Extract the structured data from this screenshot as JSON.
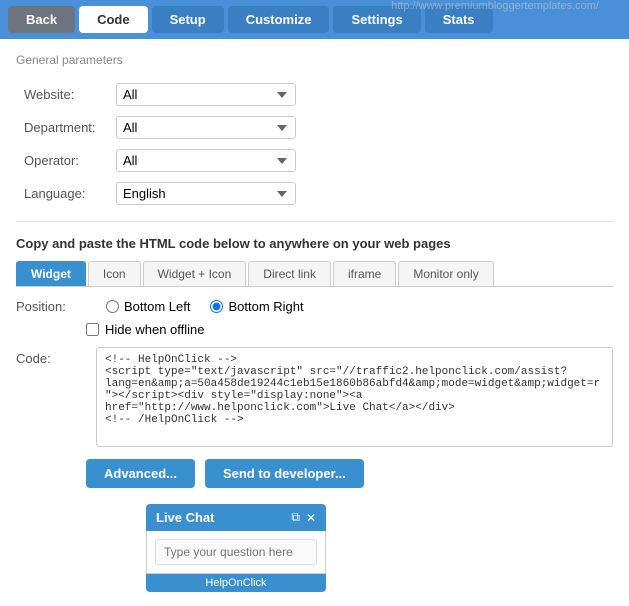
{
  "nav": {
    "back_label": "Back",
    "code_label": "Code",
    "setup_label": "Setup",
    "customize_label": "Customize",
    "settings_label": "Settings",
    "stats_label": "Stats"
  },
  "general_params": {
    "title": "General parameters",
    "website_label": "Website:",
    "website_value": "All",
    "department_label": "Department:",
    "department_value": "All",
    "operator_label": "Operator:",
    "operator_value": "All",
    "language_label": "Language:",
    "language_value": "English"
  },
  "copy_section": {
    "instruction": "Copy and paste the HTML code below to anywhere on your web pages"
  },
  "tabs": [
    {
      "id": "widget",
      "label": "Widget",
      "active": true
    },
    {
      "id": "icon",
      "label": "Icon",
      "active": false
    },
    {
      "id": "widget-icon",
      "label": "Widget + Icon",
      "active": false
    },
    {
      "id": "direct-link",
      "label": "Direct link",
      "active": false
    },
    {
      "id": "iframe",
      "label": "iframe",
      "active": false
    },
    {
      "id": "monitor-only",
      "label": "Monitor only",
      "active": false
    }
  ],
  "position": {
    "label": "Position:",
    "options": [
      {
        "id": "bottom-left",
        "label": "Bottom Left",
        "checked": false
      },
      {
        "id": "bottom-right",
        "label": "Bottom Right",
        "checked": true
      }
    ],
    "hide_offline_label": "Hide when offline"
  },
  "code_section": {
    "label": "Code:",
    "value": "<!-- HelpOnClick -->\n<script type=\"text/javascript\" src=\"//traffic2.helponclick.com/assist?lang=en&amp;a=50a458de19244c1eb15e1860b86abfd4&amp;mode=widget&amp;widget=r\"></script><div style=\"display:none\"><a href=\"http://www.helponclick.com\">Live Chat</a></div>\n<!-- /HelpOnClick -->"
  },
  "buttons": {
    "advanced_label": "Advanced...",
    "send_developer_label": "Send to developer..."
  },
  "widget_preview": {
    "title": "Live Chat",
    "external_icon": "⧉",
    "close_icon": "✕",
    "input_placeholder": "Type your question here",
    "footer": "HelpOnClick"
  },
  "watermark": "http://www.premiumbloggertemplates.com/"
}
